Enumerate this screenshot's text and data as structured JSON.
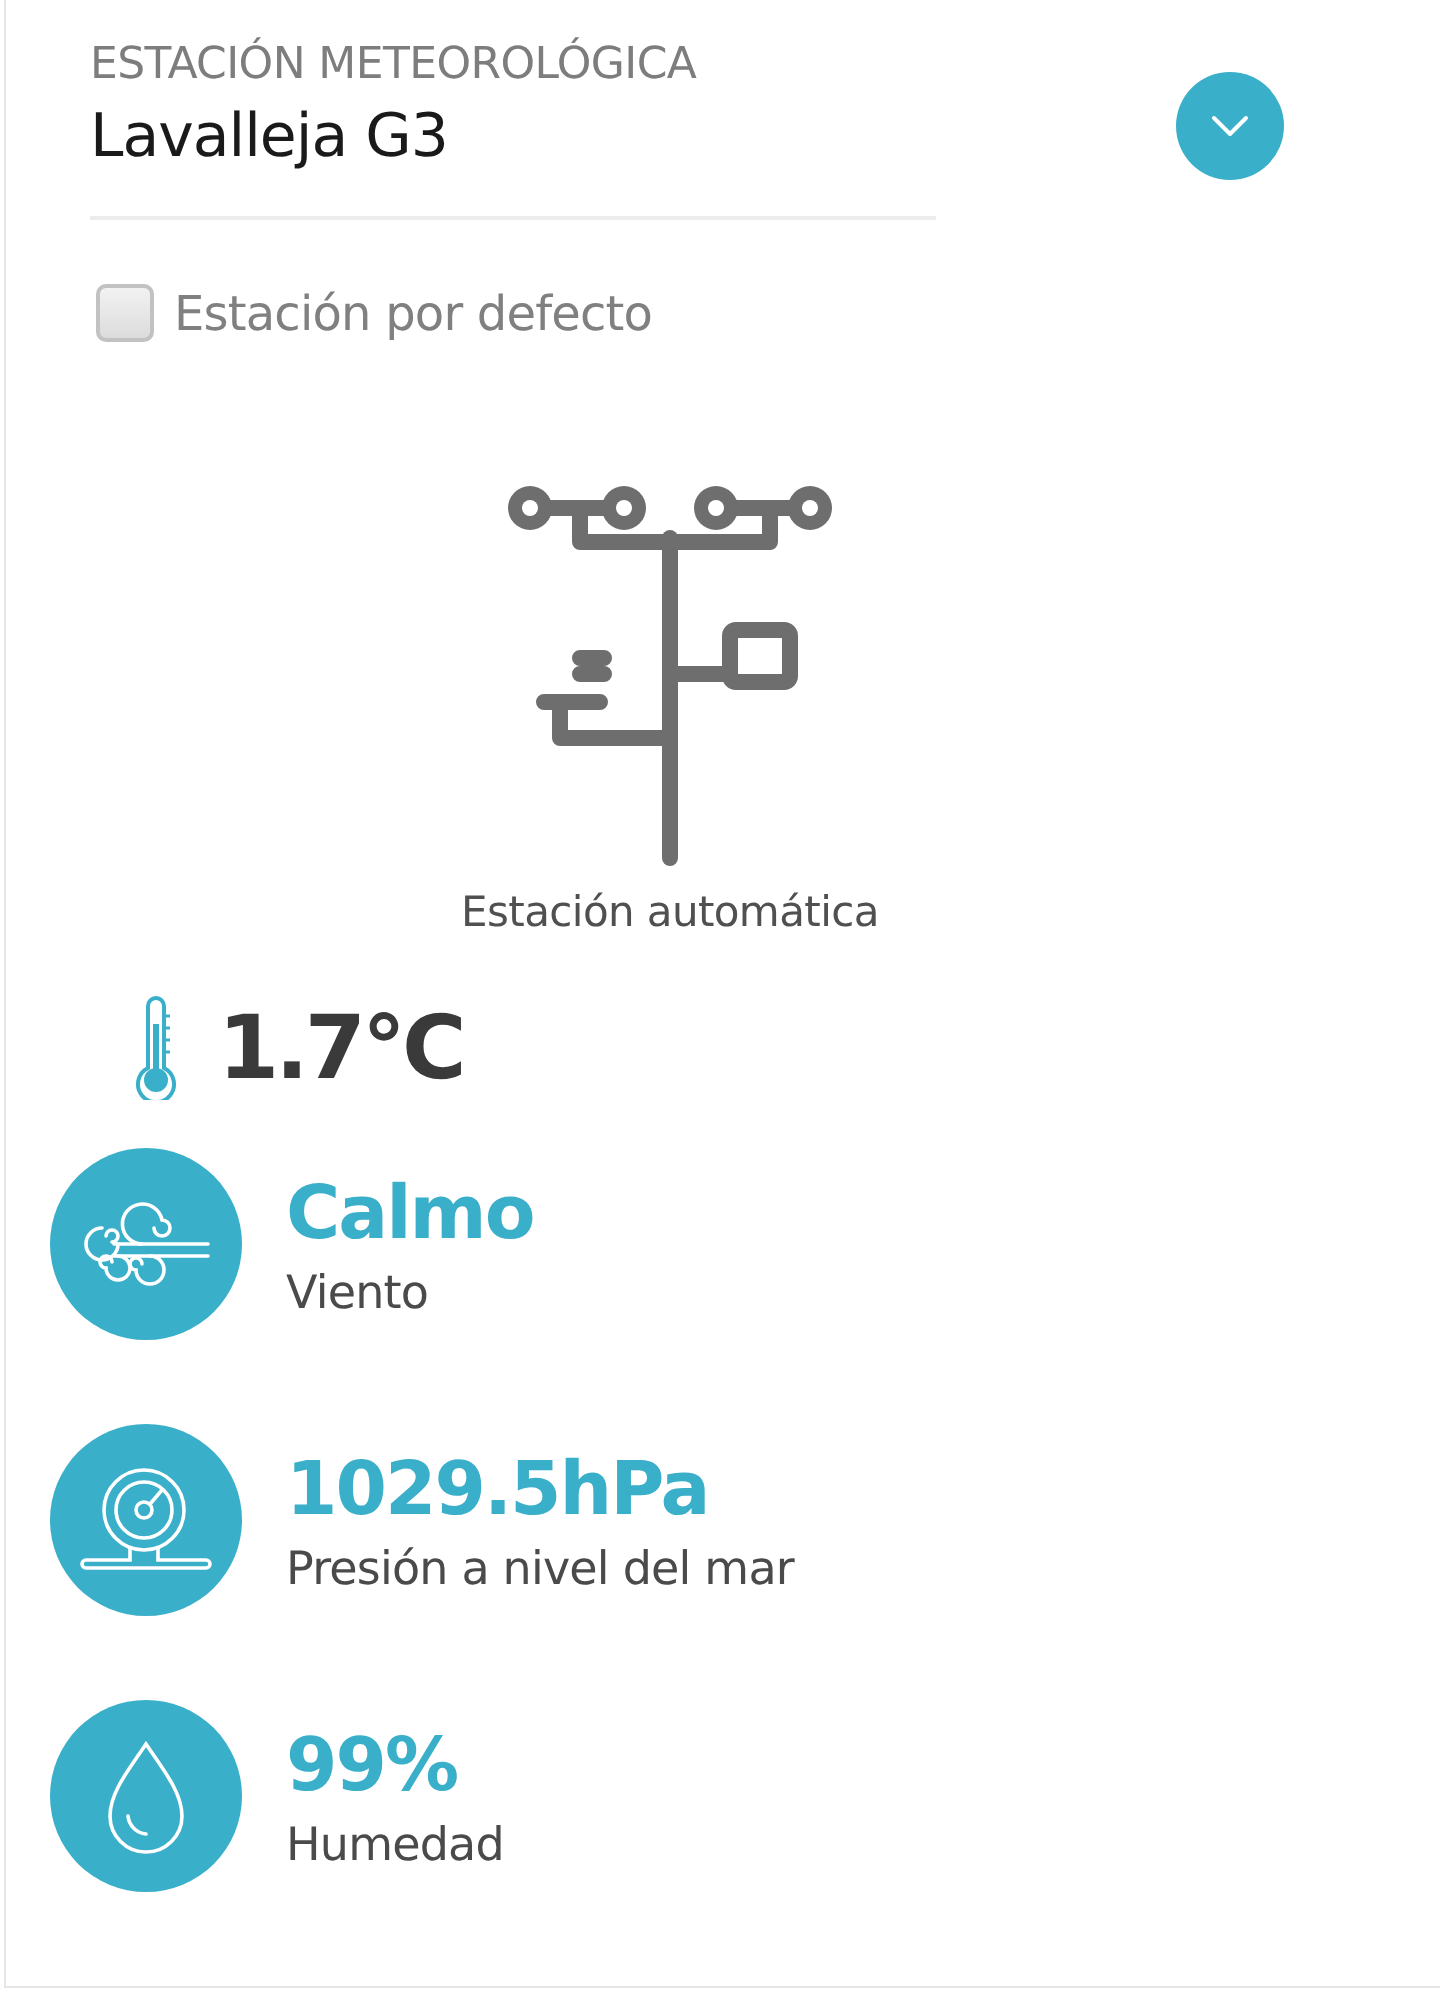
{
  "station_selector": {
    "label": "ESTACIÓN METEOROLÓGICA",
    "value": "Lavalleja G3"
  },
  "default_station": {
    "label": "Estación por defecto",
    "checked": false
  },
  "station_type": {
    "label": "Estación automática"
  },
  "temperature": "1.7°C",
  "metrics": [
    {
      "kind": "wind",
      "value": "Calmo",
      "label": "Viento"
    },
    {
      "kind": "pressure",
      "value": "1029.5hPa",
      "label": "Presión a nivel del mar"
    },
    {
      "kind": "humidity",
      "value": "99%",
      "label": "Humedad"
    }
  ]
}
